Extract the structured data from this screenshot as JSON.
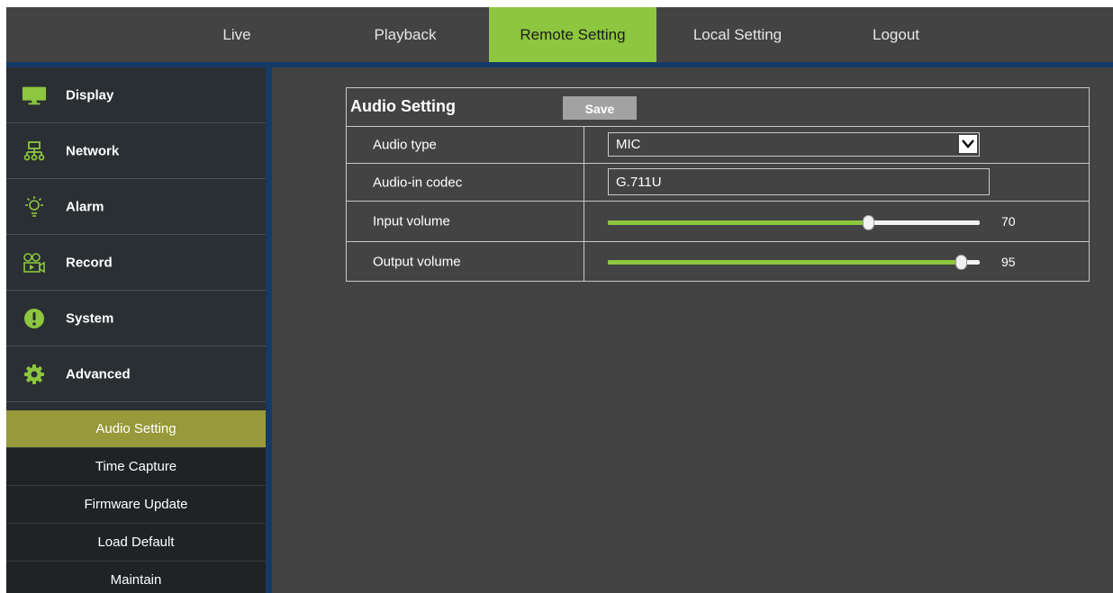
{
  "nav": {
    "tabs": [
      {
        "label": "Live"
      },
      {
        "label": "Playback"
      },
      {
        "label": "Remote Setting"
      },
      {
        "label": "Local Setting"
      },
      {
        "label": "Logout"
      }
    ],
    "active_tab": "Remote Setting"
  },
  "sidebar": {
    "items": [
      {
        "label": "Display",
        "icon": "monitor-icon"
      },
      {
        "label": "Network",
        "icon": "network-icon"
      },
      {
        "label": "Alarm",
        "icon": "alarm-icon"
      },
      {
        "label": "Record",
        "icon": "record-icon"
      },
      {
        "label": "System",
        "icon": "system-icon"
      },
      {
        "label": "Advanced",
        "icon": "gear-icon"
      }
    ],
    "sub_items": [
      {
        "label": "Audio Setting"
      },
      {
        "label": "Time Capture"
      },
      {
        "label": "Firmware Update"
      },
      {
        "label": "Load Default"
      },
      {
        "label": "Maintain"
      }
    ],
    "active_sub_item": "Audio Setting"
  },
  "panel": {
    "title": "Audio Setting",
    "save_label": "Save",
    "audio_type": {
      "label": "Audio type",
      "value": "MIC"
    },
    "audio_in_codec": {
      "label": "Audio-in codec",
      "value": "G.711U"
    },
    "input_volume": {
      "label": "Input volume",
      "value": 70,
      "value_text": "70"
    },
    "output_volume": {
      "label": "Output volume",
      "value": 95,
      "value_text": "95"
    }
  },
  "colors": {
    "accent": "#8dc63f",
    "active_sub_item": "#97993a",
    "nav_line": "#163a66",
    "background": "#434343"
  }
}
